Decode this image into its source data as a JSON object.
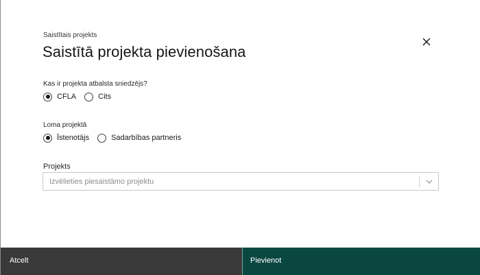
{
  "dialog": {
    "eyebrow": "Saistītais projekts",
    "title": "Saistītā projekta pievienošana",
    "close_icon": "close-icon"
  },
  "support_provider": {
    "label": "Kas ir projekta atbalsta sniedzējs?",
    "options": [
      {
        "label": "CFLA",
        "checked": true
      },
      {
        "label": "Cits",
        "checked": false
      }
    ]
  },
  "role": {
    "label": "Loma projektā",
    "options": [
      {
        "label": "Īstenotājs",
        "checked": true
      },
      {
        "label": "Sadarbības partneris",
        "checked": false
      }
    ]
  },
  "project": {
    "label": "Projekts",
    "placeholder": "Izvēlieties piesaistāmo projektu",
    "chevron_icon": "chevron-down-icon"
  },
  "footer": {
    "cancel_label": "Atcelt",
    "submit_label": "Pievienot",
    "colors": {
      "cancel_bg": "#393939",
      "submit_bg": "#0b4741"
    }
  }
}
